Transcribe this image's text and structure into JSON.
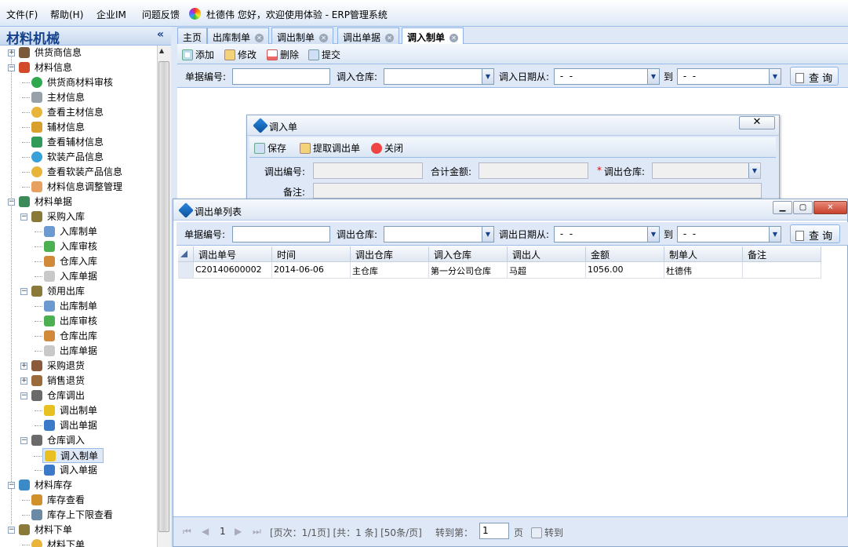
{
  "menubar": {
    "items": [
      "文件(F)",
      "帮助(H)",
      "企业IM",
      "问题反馈"
    ],
    "welcome": "杜德伟 您好，欢迎使用体验 - ERP管理系统"
  },
  "left_panel": {
    "title": "材料机械",
    "collapse_glyph": "«",
    "tree": [
      {
        "label": "供货商信息",
        "level": 0,
        "icon": "user-icon"
      },
      {
        "label": "材料信息",
        "level": 0,
        "icon": "home-icon"
      },
      {
        "label": "供货商材料审核",
        "level": 1,
        "icon": "check-icon"
      },
      {
        "label": "主材信息",
        "level": 1,
        "icon": "wrench-icon"
      },
      {
        "label": "查看主材信息",
        "level": 1,
        "icon": "coin-icon"
      },
      {
        "label": "辅材信息",
        "level": 1,
        "icon": "pen-icon"
      },
      {
        "label": "查看辅材信息",
        "level": 1,
        "icon": "box-icon"
      },
      {
        "label": "软装产品信息",
        "level": 1,
        "icon": "gear-icon"
      },
      {
        "label": "查看软装产品信息",
        "level": 1,
        "icon": "coin-icon"
      },
      {
        "label": "材料信息调整管理",
        "level": 1,
        "icon": "heart-icon"
      },
      {
        "label": "材料单据",
        "level": 0,
        "icon": "sheet-icon"
      },
      {
        "label": "采购入库",
        "level": 1,
        "icon": "tools-icon"
      },
      {
        "label": "入库制单",
        "level": 2,
        "icon": "flow-icon"
      },
      {
        "label": "入库审核",
        "level": 2,
        "icon": "doc-check-icon"
      },
      {
        "label": "仓库入库",
        "level": 2,
        "icon": "warehouse-icon"
      },
      {
        "label": "入库单据",
        "level": 2,
        "icon": "doc-icon"
      },
      {
        "label": "领用出库",
        "level": 1,
        "icon": "tools-icon"
      },
      {
        "label": "出库制单",
        "level": 2,
        "icon": "flow-icon"
      },
      {
        "label": "出库审核",
        "level": 2,
        "icon": "doc-check-icon"
      },
      {
        "label": "仓库出库",
        "level": 2,
        "icon": "warehouse-icon"
      },
      {
        "label": "出库单据",
        "level": 2,
        "icon": "doc-icon"
      },
      {
        "label": "采购退货",
        "level": 1,
        "icon": "return-icon"
      },
      {
        "label": "销售退货",
        "level": 1,
        "icon": "bag-icon"
      },
      {
        "label": "仓库调出",
        "level": 1,
        "icon": "transfer-icon"
      },
      {
        "label": "调出制单",
        "level": 2,
        "icon": "star-icon"
      },
      {
        "label": "调出单据",
        "level": 2,
        "icon": "chart-icon"
      },
      {
        "label": "仓库调入",
        "level": 1,
        "icon": "transfer-icon"
      },
      {
        "label": "调入制单",
        "level": 2,
        "icon": "star-icon"
      },
      {
        "label": "调入单据",
        "level": 2,
        "icon": "chart-icon"
      },
      {
        "label": "材料库存",
        "level": 0,
        "icon": "globe-icon"
      },
      {
        "label": "库存查看",
        "level": 1,
        "icon": "list-icon"
      },
      {
        "label": "库存上下限查看",
        "level": 1,
        "icon": "building-icon"
      },
      {
        "label": "材料下单",
        "level": 0,
        "icon": "tools-icon"
      },
      {
        "label": "材料下单",
        "level": 1,
        "icon": "coin-icon"
      }
    ]
  },
  "tabs": [
    {
      "label": "主页",
      "closable": false
    },
    {
      "label": "出库制单",
      "closable": true
    },
    {
      "label": "调出制单",
      "closable": true
    },
    {
      "label": "调出单据",
      "closable": true
    },
    {
      "label": "调入制单",
      "closable": true,
      "active": true
    }
  ],
  "toolbar": {
    "add": "添加",
    "edit": "修改",
    "delete": "删除",
    "submit": "提交"
  },
  "search": {
    "doc_no_label": "单据编号:",
    "warehouse_in_label": "调入仓库:",
    "date_from_label": "调入日期从:",
    "date_from_value": " -  - ",
    "to_label": "到",
    "date_to_value": " -  - ",
    "query_button": "查 询"
  },
  "dialog_in": {
    "title": "调入单",
    "save": "保存",
    "fetch": "提取调出单",
    "close": "关闭",
    "out_no_label": "调出编号:",
    "total_label": "合计金额:",
    "out_warehouse_label": "调出仓库:",
    "required_mark": "*",
    "remark_label": "备注:"
  },
  "dialog_list": {
    "title": "调出单列表",
    "doc_no_label": "单据编号:",
    "warehouse_out_label": "调出仓库:",
    "date_from_label": "调出日期从:",
    "date_from_value": " -  - ",
    "to_label": "到",
    "date_to_value": " -  - ",
    "query_button": "查 询",
    "columns": [
      "调出单号",
      "时间",
      "调出仓库",
      "调入仓库",
      "调出人",
      "金额",
      "制单人",
      "备注"
    ],
    "rows": [
      [
        "C20140600002",
        "2014-06-06",
        "主仓库",
        "第一分公司仓库",
        "马超",
        "1056.00",
        "杜德伟",
        ""
      ]
    ],
    "pager": {
      "page": "1",
      "info": "[页次：1/1页] [共：1 条] [50条/页]",
      "goto_label": "转到第：",
      "goto_value": "1",
      "page_unit": "页",
      "goto_button": "转到"
    }
  }
}
